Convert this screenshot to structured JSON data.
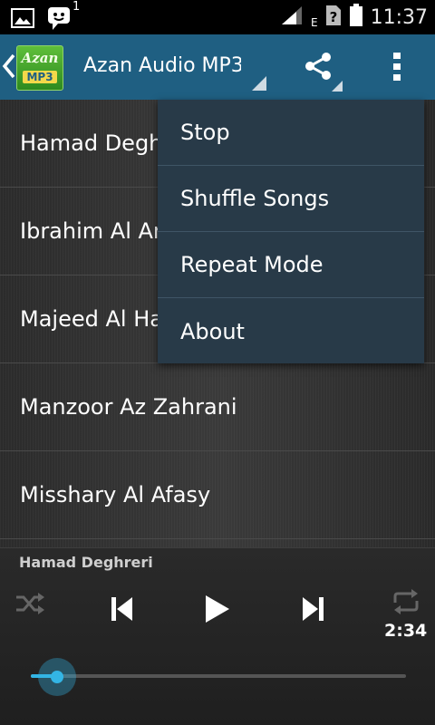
{
  "status_bar": {
    "time": "11:37",
    "notification_count": "1",
    "icons": [
      "image-icon",
      "chat-bubble-icon",
      "signal-icon",
      "data-e-icon",
      "sim-unknown-icon",
      "battery-icon"
    ],
    "data_label": "E"
  },
  "action_bar": {
    "logo_top": "Azan",
    "logo_bottom": "MP3",
    "title": "Azan Audio MP3",
    "color": "#1f5f82"
  },
  "songs": [
    "Hamad Deghreri",
    "Ibrahim Al Arkani",
    "Majeed Al Haeri",
    "Manzoor Az Zahrani",
    "Misshary Al Afasy"
  ],
  "menu": {
    "items": [
      "Stop",
      "Shuffle Songs",
      "Repeat Mode",
      "About"
    ]
  },
  "player": {
    "now_playing": "Hamad Deghreri",
    "time": "2:34",
    "progress_fraction": 0.07,
    "accent": "#33b5e5"
  }
}
